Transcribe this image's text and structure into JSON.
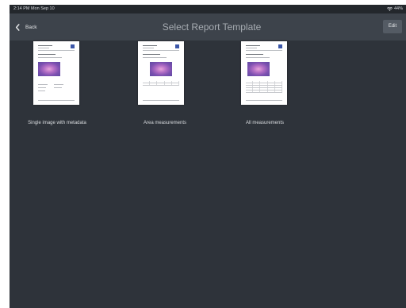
{
  "status_bar": {
    "time": "2:14 PM",
    "date": "Mon Sep 10",
    "battery": "44%"
  },
  "nav": {
    "back_label": "Back",
    "title": "Select Report Template",
    "edit_label": "Edit"
  },
  "templates": [
    {
      "label": "Single image with metadata"
    },
    {
      "label": "Area measurements"
    },
    {
      "label": "All measurements"
    }
  ],
  "icons": {
    "back": "chevron-left-icon",
    "wifi": "wifi-icon"
  }
}
